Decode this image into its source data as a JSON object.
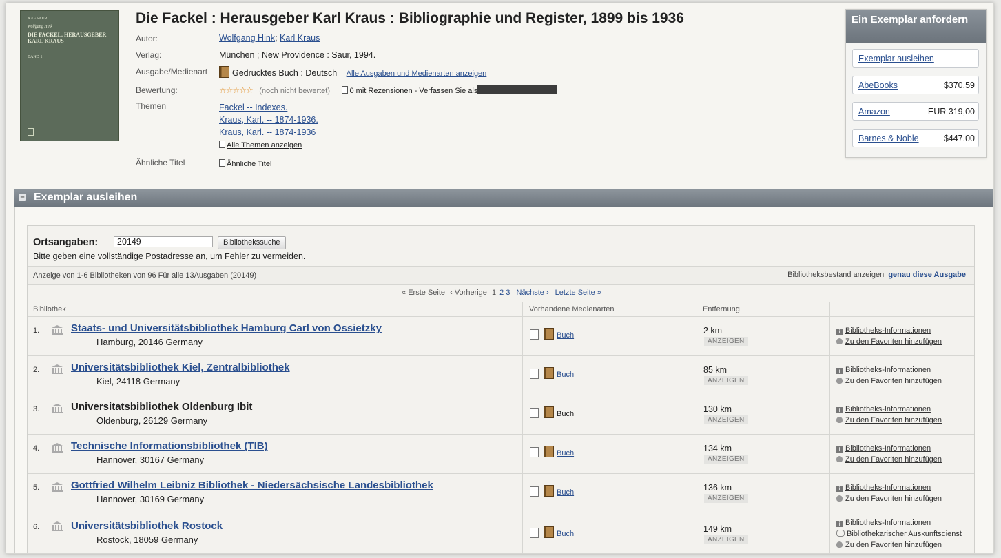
{
  "book": {
    "title": "Die Fackel : Herausgeber Karl Kraus : Bibliographie und Register, 1899 bis 1936",
    "cover": {
      "publisher": "K·G·SAUR",
      "author": "Wolfgang Hink",
      "title": "DIE FACKEL. HERAUSGEBER KARL KRAUS",
      "volume": "BAND 1"
    },
    "labels": {
      "author": "Autor:",
      "publisher": "Verlag:",
      "edition": "Ausgabe/Medienart",
      "rating": "Bewertung:",
      "subjects": "Themen",
      "similar": "Ähnliche Titel"
    },
    "authors": [
      "Wolfgang Hink",
      "Karl Kraus"
    ],
    "author_sep": ";",
    "publisher": "München ; New Providence : Saur, 1994.",
    "edition": "Gedrucktes Buch : Deutsch",
    "edition_link": "Alle Ausgaben und Medienarten anzeigen",
    "rating_stars": "☆☆☆☆☆",
    "rating_note": "(noch nicht bewertet)",
    "review_link": "0 mit Rezensionen - Verfassen Sie als",
    "subjects": [
      "Fackel -- Indexes.",
      "Kraus, Karl. -- 1874-1936.",
      "Kraus, Karl. -- 1874-1936"
    ],
    "all_subjects_link": "Alle Themen anzeigen",
    "similar_link": "Ähnliche Titel"
  },
  "request_box": {
    "title": "Ein Exemplar anfordern",
    "borrow": "Exemplar ausleihen",
    "vendors": [
      {
        "name": "AbeBooks",
        "price": "$370.59"
      },
      {
        "name": "Amazon",
        "price": "EUR 319,00"
      },
      {
        "name": "Barnes & Noble",
        "price": "$447.00"
      }
    ]
  },
  "section": {
    "toggle": "–",
    "title": "Exemplar ausleihen",
    "location_label": "Ortsangaben:",
    "location_value": "20149",
    "search_button": "Bibliothekssuche",
    "hint": "Bitte geben eine vollständige Postadresse an, um Fehler zu vermeiden.",
    "count_text": "Anzeige von 1-6 Bibliotheken von 96 Für alle 13Ausgaben (20149)",
    "holdings_label": "Bibliotheksbestand anzeigen",
    "holdings_link": "genau diese Ausgabe",
    "pager": {
      "first": "« Erste Seite",
      "prev": "‹ Vorherige",
      "current": "1",
      "pages": [
        "2",
        "3"
      ],
      "next": "Nächste ›",
      "last": "Letzte Seite »"
    },
    "columns": [
      "Bibliothek",
      "Vorhandene Medienarten",
      "Entfernung"
    ]
  },
  "libraries": [
    {
      "num": "1.",
      "name": "Staats- und Universitätsbibliothek Hamburg Carl von Ossietzky",
      "addr": "Hamburg, 20146 Germany",
      "media": "Buch",
      "dist": "2 km",
      "show": "ANZEIGEN",
      "a1": "Bibliotheks-Informationen",
      "a2": "Zu den Favoriten hinzufügen"
    },
    {
      "num": "2.",
      "name": "Universitätsbibliothek Kiel, Zentralbibliothek",
      "addr": "Kiel, 24118 Germany",
      "media": "Buch",
      "dist": "85 km",
      "show": "ANZEIGEN",
      "a1": "Bibliotheks-Informationen",
      "a2": "Zu den Favoriten hinzufügen"
    },
    {
      "num": "3.",
      "name": "Universitatsbibliothek Oldenburg Ibit",
      "addr": "Oldenburg, 26129 Germany",
      "media": "Buch",
      "dist": "130 km",
      "show": "ANZEIGEN",
      "a1": "Bibliotheks-Informationen",
      "a2": "Zu den Favoriten hinzufügen"
    },
    {
      "num": "4.",
      "name": "Technische Informationsbibliothek (TIB)",
      "addr": "Hannover, 30167 Germany",
      "media": "Buch",
      "dist": "134 km",
      "show": "ANZEIGEN",
      "a1": "Bibliotheks-Informationen",
      "a2": "Zu den Favoriten hinzufügen"
    },
    {
      "num": "5.",
      "name": "Gottfried Wilhelm Leibniz Bibliothek - Niedersächsische Landesbibliothek",
      "addr": "Hannover, 30169 Germany",
      "media": "Buch",
      "dist": "136 km",
      "show": "ANZEIGEN",
      "a1": "Bibliotheks-Informationen",
      "a2": "Zu den Favoriten hinzufügen"
    },
    {
      "num": "6.",
      "name": "Universitätsbibliothek Rostock",
      "addr": "Rostock, 18059 Germany",
      "media": "Buch",
      "dist": "149 km",
      "show": "ANZEIGEN",
      "a1": "Bibliotheks-Informationen",
      "a1b": "Bibliothekarischer Auskunftsdienst",
      "a2": "Zu den Favoriten hinzufügen"
    }
  ]
}
